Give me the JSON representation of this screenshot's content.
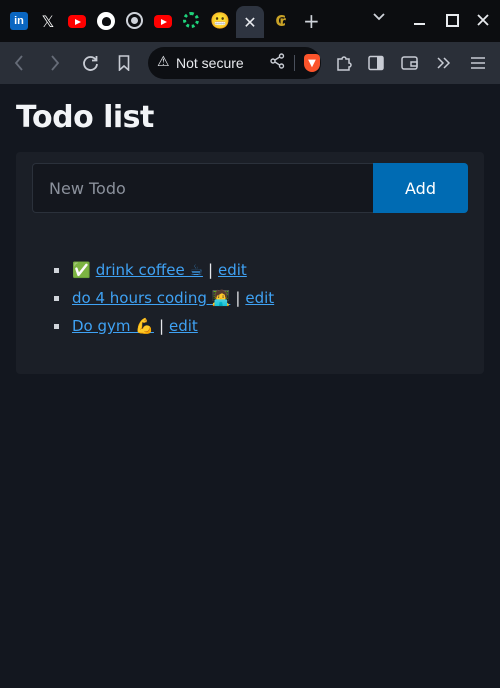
{
  "browser": {
    "tabs": [
      {
        "icon": "linkedin-icon",
        "glyph": "in"
      },
      {
        "icon": "x-icon",
        "glyph": "𝕏"
      },
      {
        "icon": "youtube-icon"
      },
      {
        "icon": "github-icon"
      },
      {
        "icon": "globe-icon"
      },
      {
        "icon": "youtube-icon"
      },
      {
        "icon": "loading-ring-icon"
      },
      {
        "icon": "grimace-emoji-icon",
        "glyph": "😬"
      },
      {
        "icon": "close-icon",
        "glyph": "✕",
        "active": true
      },
      {
        "icon": "c-logo-icon",
        "glyph": "₢"
      }
    ],
    "new_tab_glyph": "+",
    "address_bar": {
      "security_label": "Not secure",
      "warning_glyph": "⚠"
    }
  },
  "page": {
    "title": "Todo list",
    "input_placeholder": "New Todo",
    "add_label": "Add",
    "separator": "|",
    "todos": [
      {
        "done_glyph": "✅",
        "text": "drink coffee ☕",
        "edit": "edit"
      },
      {
        "text": "do 4 hours coding 🧑‍💻",
        "edit": "edit"
      },
      {
        "text": "Do gym 💪",
        "edit": "edit"
      }
    ]
  },
  "colors": {
    "page_bg": "#13171f",
    "card_bg": "#1b1f27",
    "accent": "#006bb3",
    "link": "#3fa2f4"
  }
}
